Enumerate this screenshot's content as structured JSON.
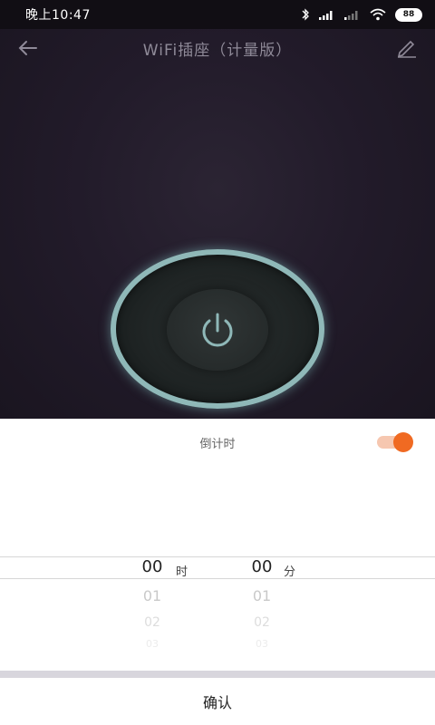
{
  "status_bar": {
    "time": "晚上10:47",
    "battery": "88",
    "icons": [
      "bluetooth-icon",
      "signal-icon",
      "signal-weak-icon",
      "wifi-icon",
      "battery-icon"
    ]
  },
  "header": {
    "title": "WiFi插座（计量版）",
    "back_icon": "back-arrow-icon",
    "edit_icon": "edit-pencil-icon"
  },
  "power": {
    "icon": "power-icon",
    "ring_color": "#8fb8b8"
  },
  "countdown": {
    "label": "倒计时",
    "toggle_on": true,
    "accent_color": "#f06a22"
  },
  "picker": {
    "hours": {
      "selected": "00",
      "unit": "时",
      "next": [
        "01",
        "02",
        "03"
      ]
    },
    "minutes": {
      "selected": "00",
      "unit": "分",
      "next": [
        "01",
        "02",
        "03"
      ]
    }
  },
  "confirm_label": "确认"
}
